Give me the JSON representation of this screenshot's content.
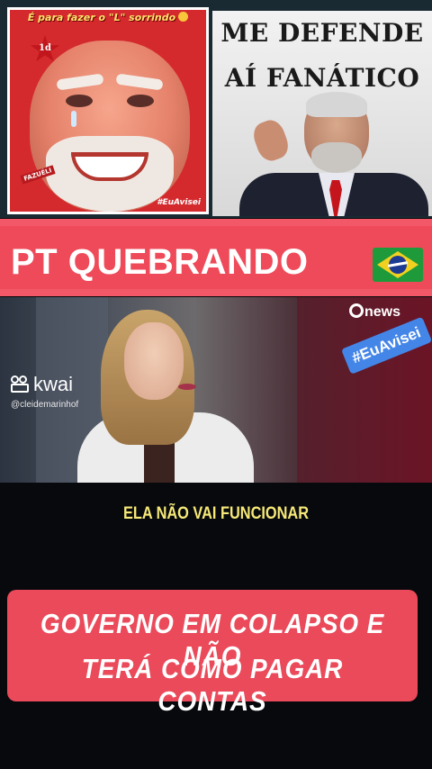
{
  "top_memes": {
    "left": {
      "caption": "É para fazer o \"L\" sorrindo",
      "badge": "1d",
      "small_tag": "FAZUÉLI",
      "watermark": "#EuAvisei"
    },
    "right": {
      "line1": "ME DEFENDE",
      "line2": "AÍ FANÁTICO"
    }
  },
  "title_banner": {
    "text": "PT QUEBRANDO",
    "flag_icon": "brazil-flag-icon"
  },
  "video": {
    "kwai_brand": "kwai",
    "kwai_user": "@cleidemarinhof",
    "news_brand": "news",
    "hashtag": "#EuAvisei",
    "caption": "ELA NÃO VAI FUNCIONAR"
  },
  "bottom_banner": {
    "line1": "GOVERNO EM COLAPSO E NÃO",
    "line2": "TERÁ COMO PAGAR  CONTAS"
  },
  "colors": {
    "banner_red": "#ef4a59",
    "caption_yellow": "#f6e977",
    "hashtag_blue": "#4486e8"
  }
}
